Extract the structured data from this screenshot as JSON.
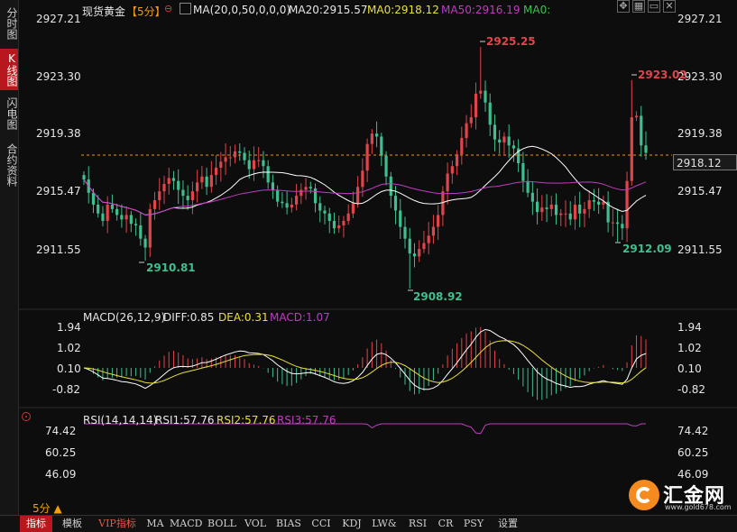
{
  "side_tabs": [
    {
      "label": "分时图",
      "active": false
    },
    {
      "label": "K线图",
      "active": true
    },
    {
      "label": "闪电图",
      "active": false
    },
    {
      "label": "合约资料",
      "active": false
    }
  ],
  "header": {
    "symbol": "现货黄金",
    "period": "【5分】",
    "ma_params": "MA(20,0,50,0,0,0)",
    "ma20": "MA20:2915.57",
    "ma0": "MA0:2918.12",
    "ma50": "MA50:2916.19",
    "ma0b": "MA0:"
  },
  "price_axis": [
    "2927.21",
    "2923.30",
    "2919.38",
    "2915.47",
    "2911.55"
  ],
  "current_price": "2918.12",
  "annotations": {
    "high": "2925.25",
    "high2": "2923.02",
    "low1": "2910.81",
    "low2": "2908.92",
    "low3": "2912.09"
  },
  "macd": {
    "title": "MACD(26,12,9)",
    "diff": "DIFF:0.85",
    "dea": "DEA:0.31",
    "macd": "MACD:1.07",
    "axis": [
      "1.94",
      "1.02",
      "0.10",
      "-0.82"
    ]
  },
  "rsi": {
    "title": "RSI(14,14,14)",
    "rsi1": "RSI1:57.76",
    "rsi2": "RSI2:57.76",
    "rsi3": "RSI3:57.76",
    "axis": [
      "74.42",
      "60.25",
      "46.09"
    ]
  },
  "period_selector": "5分 ▲",
  "toolbar": [
    "指标",
    "模板",
    "VIP指标",
    "MA",
    "MACD",
    "BOLL",
    "VOL",
    "BIAS",
    "CCI",
    "KDJ",
    "LW&",
    "RSI",
    "CR",
    "PSY",
    "设置"
  ],
  "logo": {
    "name": "汇金网",
    "url": "www.gold678.com"
  },
  "colors": {
    "up": "#e0454b",
    "down": "#3fbf8f",
    "ma20": "#ffffff",
    "ma50": "#c03cc0",
    "diff": "#ffffff",
    "dea": "#e8e03a",
    "rsi": "#c03cc0",
    "accent": "#b8181d"
  },
  "chart_data": {
    "type": "candlestick",
    "price_range": [
      2908.92,
      2925.25
    ],
    "closes": [
      2916.3,
      2915.4,
      2914.6,
      2914.0,
      2913.5,
      2914.6,
      2914.3,
      2913.9,
      2913.6,
      2913.9,
      2913.3,
      2913.2,
      2912.3,
      2911.7,
      2914.3,
      2914.9,
      2915.5,
      2916.0,
      2916.4,
      2916.2,
      2915.6,
      2915.2,
      2914.9,
      2915.5,
      2916.1,
      2916.5,
      2915.8,
      2916.6,
      2917.1,
      2917.5,
      2917.8,
      2917.8,
      2918.2,
      2918.1,
      2917.6,
      2917.0,
      2917.6,
      2917.6,
      2917.2,
      2916.1,
      2915.6,
      2914.8,
      2914.7,
      2914.4,
      2914.6,
      2915.2,
      2915.6,
      2915.8,
      2915.7,
      2914.7,
      2914.2,
      2914.0,
      2913.5,
      2913.0,
      2913.2,
      2913.5,
      2914.0,
      2914.7,
      2915.8,
      2916.9,
      2918.7,
      2919.4,
      2919.2,
      2917.9,
      2916.5,
      2915.2,
      2914.2,
      2913.1,
      2912.3,
      2911.3,
      2911.1,
      2911.6,
      2912.0,
      2912.5,
      2913.1,
      2913.9,
      2915.5,
      2916.7,
      2917.2,
      2918.0,
      2919.1,
      2920.1,
      2920.5,
      2922.1,
      2922.3,
      2921.5,
      2920.0,
      2919.0,
      2918.8,
      2919.2,
      2918.6,
      2918.4,
      2917.4,
      2916.2,
      2915.4,
      2914.8,
      2914.1,
      2914.4,
      2914.3,
      2914.6,
      2913.9,
      2914.0,
      2914.0,
      2913.6,
      2914.6,
      2914.0,
      2914.3,
      2914.9,
      2914.8,
      2914.6,
      2914.8,
      2913.4,
      2913.4,
      2913.3,
      2913.0,
      2916.2,
      2920.5,
      2920.6,
      2918.6,
      2918.1
    ]
  }
}
